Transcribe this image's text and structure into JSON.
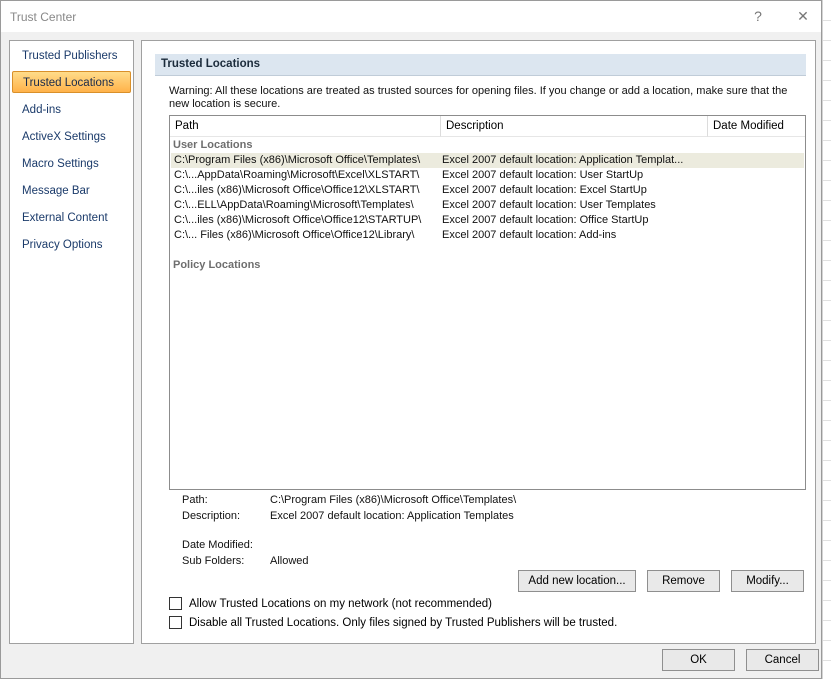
{
  "window": {
    "title": "Trust Center",
    "help_glyph": "?",
    "close_glyph": "✕"
  },
  "sidebar": {
    "items": [
      {
        "label": "Trusted Publishers",
        "active": false
      },
      {
        "label": "Trusted Locations",
        "active": true
      },
      {
        "label": "Add-ins",
        "active": false
      },
      {
        "label": "ActiveX Settings",
        "active": false
      },
      {
        "label": "Macro Settings",
        "active": false
      },
      {
        "label": "Message Bar",
        "active": false
      },
      {
        "label": "External Content",
        "active": false
      },
      {
        "label": "Privacy Options",
        "active": false
      }
    ]
  },
  "main": {
    "section_title": "Trusted Locations",
    "warning": "Warning: All these locations are treated as trusted sources for opening files.  If you change or add a location, make sure that the new location is secure.",
    "table": {
      "headers": {
        "path": "Path",
        "description": "Description",
        "date_modified": "Date Modified"
      },
      "user_group_label": "User Locations",
      "policy_group_label": "Policy Locations",
      "rows": [
        {
          "path": "C:\\Program Files (x86)\\Microsoft Office\\Templates\\",
          "description": "Excel 2007 default location: Application Templat...",
          "date": "",
          "selected": true
        },
        {
          "path": "C:\\...AppData\\Roaming\\Microsoft\\Excel\\XLSTART\\",
          "description": "Excel 2007 default location: User StartUp",
          "date": "",
          "selected": false
        },
        {
          "path": "C:\\...iles (x86)\\Microsoft Office\\Office12\\XLSTART\\",
          "description": "Excel 2007 default location: Excel StartUp",
          "date": "",
          "selected": false
        },
        {
          "path": "C:\\...ELL\\AppData\\Roaming\\Microsoft\\Templates\\",
          "description": "Excel 2007 default location: User Templates",
          "date": "",
          "selected": false
        },
        {
          "path": "C:\\...iles (x86)\\Microsoft Office\\Office12\\STARTUP\\",
          "description": "Excel 2007 default location: Office StartUp",
          "date": "",
          "selected": false
        },
        {
          "path": "C:\\... Files (x86)\\Microsoft Office\\Office12\\Library\\",
          "description": "Excel 2007 default location: Add-ins",
          "date": "",
          "selected": false
        }
      ]
    },
    "details": {
      "path_label": "Path:",
      "path_value": "C:\\Program Files (x86)\\Microsoft Office\\Templates\\",
      "description_label": "Description:",
      "description_value": "Excel 2007 default location: Application Templates",
      "date_label": "Date Modified:",
      "date_value": "",
      "subfolders_label": "Sub Folders:",
      "subfolders_value": "Allowed"
    },
    "buttons": {
      "add": "Add new location...",
      "remove": "Remove",
      "modify": "Modify..."
    },
    "checkboxes": {
      "allow_network": {
        "label": "Allow Trusted Locations on my network (not recommended)",
        "checked": false
      },
      "disable_all": {
        "label": "Disable all Trusted Locations. Only files signed by Trusted Publishers will be trusted.",
        "checked": false
      }
    }
  },
  "footer": {
    "ok": "OK",
    "cancel": "Cancel"
  }
}
